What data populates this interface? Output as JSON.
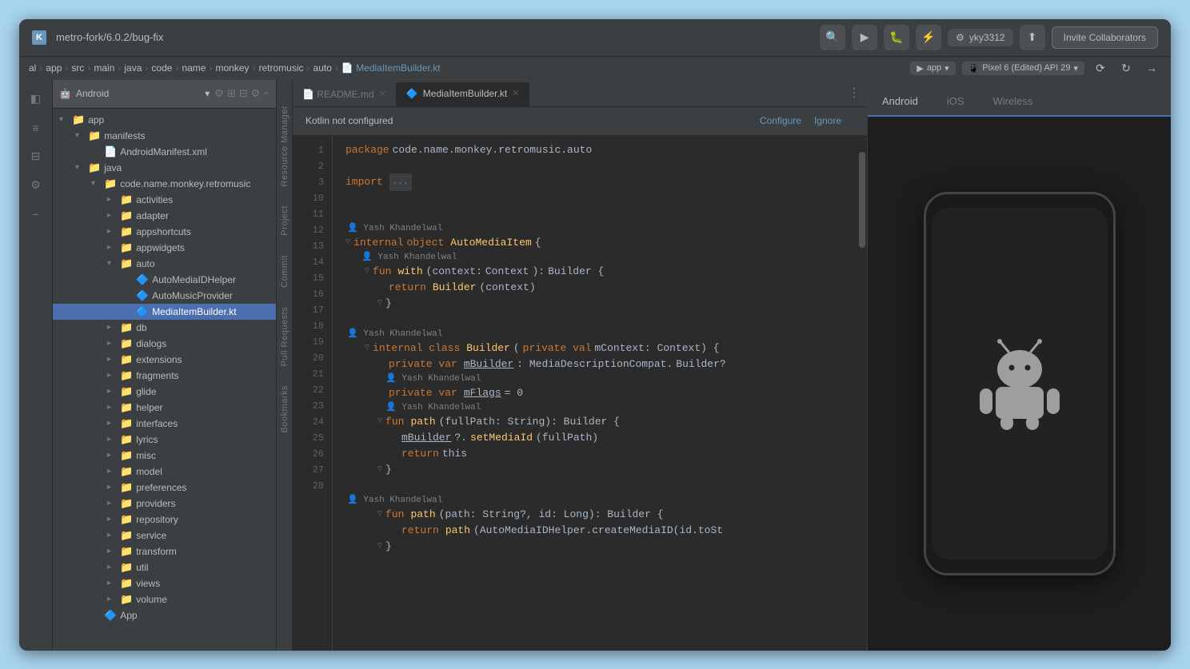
{
  "window": {
    "title": "metro-fork/6.0.2/bug-fix"
  },
  "titlebar": {
    "logo": "K",
    "title": "metro-fork/6.0.2/bug-fix",
    "invite_label": "Invite Collaborators",
    "github_user": "yky3312"
  },
  "breadcrumb": {
    "items": [
      "al",
      "app",
      "src",
      "main",
      "java",
      "code",
      "name",
      "monkey",
      "retromusic",
      "auto"
    ],
    "file": "MediaItemBuilder.kt"
  },
  "run_config": {
    "label": "▶ app"
  },
  "device_config": {
    "label": "📱 Pixel 6 (Edited) API 29"
  },
  "project_panel": {
    "title": "Android",
    "view": "Android"
  },
  "file_tree": [
    {
      "indent": 0,
      "type": "folder",
      "label": "app",
      "expanded": true
    },
    {
      "indent": 1,
      "type": "folder",
      "label": "manifests",
      "expanded": true
    },
    {
      "indent": 2,
      "type": "xml",
      "label": "AndroidManifest.xml"
    },
    {
      "indent": 1,
      "type": "folder",
      "label": "java",
      "expanded": true
    },
    {
      "indent": 2,
      "type": "folder",
      "label": "code.name.monkey.retromusic",
      "expanded": true
    },
    {
      "indent": 3,
      "type": "folder",
      "label": "activities",
      "expanded": false
    },
    {
      "indent": 3,
      "type": "folder",
      "label": "adapter",
      "expanded": false
    },
    {
      "indent": 3,
      "type": "folder",
      "label": "appshortcuts",
      "expanded": false
    },
    {
      "indent": 3,
      "type": "folder",
      "label": "appwidgets",
      "expanded": false
    },
    {
      "indent": 3,
      "type": "folder",
      "label": "auto",
      "expanded": true
    },
    {
      "indent": 4,
      "type": "kt",
      "label": "AutoMediaIDHelper"
    },
    {
      "indent": 4,
      "type": "kt",
      "label": "AutoMusicProvider"
    },
    {
      "indent": 4,
      "type": "kt",
      "label": "MediaItemBuilder.kt",
      "selected": true
    },
    {
      "indent": 3,
      "type": "folder",
      "label": "db",
      "expanded": false
    },
    {
      "indent": 3,
      "type": "folder",
      "label": "dialogs",
      "expanded": false
    },
    {
      "indent": 3,
      "type": "folder",
      "label": "extensions",
      "expanded": false
    },
    {
      "indent": 3,
      "type": "folder",
      "label": "fragments",
      "expanded": false
    },
    {
      "indent": 3,
      "type": "folder",
      "label": "glide",
      "expanded": false
    },
    {
      "indent": 3,
      "type": "folder",
      "label": "helper",
      "expanded": false
    },
    {
      "indent": 3,
      "type": "folder",
      "label": "interfaces",
      "expanded": false
    },
    {
      "indent": 3,
      "type": "folder",
      "label": "lyrics",
      "expanded": false
    },
    {
      "indent": 3,
      "type": "folder",
      "label": "misc",
      "expanded": false
    },
    {
      "indent": 3,
      "type": "folder",
      "label": "model",
      "expanded": false
    },
    {
      "indent": 3,
      "type": "folder",
      "label": "preferences",
      "expanded": false
    },
    {
      "indent": 3,
      "type": "folder",
      "label": "providers",
      "expanded": false
    },
    {
      "indent": 3,
      "type": "folder",
      "label": "repository",
      "expanded": false
    },
    {
      "indent": 3,
      "type": "folder",
      "label": "service",
      "expanded": false
    },
    {
      "indent": 3,
      "type": "folder",
      "label": "transform",
      "expanded": false
    },
    {
      "indent": 3,
      "type": "folder",
      "label": "util",
      "expanded": false
    },
    {
      "indent": 3,
      "type": "folder",
      "label": "views",
      "expanded": false
    },
    {
      "indent": 3,
      "type": "folder",
      "label": "volume",
      "expanded": false
    },
    {
      "indent": 2,
      "type": "kt",
      "label": "App"
    }
  ],
  "editor_tabs": [
    {
      "label": "README.md",
      "active": false,
      "closeable": true
    },
    {
      "label": "MediaItemBuilder.kt",
      "active": true,
      "closeable": true
    }
  ],
  "config_banner": {
    "text": "Kotlin not configured",
    "configure_label": "Configure",
    "ignore_label": "Ignore"
  },
  "code": {
    "lines": [
      {
        "num": 1,
        "content": "package code.name.monkey.retromusic.auto"
      },
      {
        "num": 2,
        "content": ""
      },
      {
        "num": 3,
        "content": "import ..."
      },
      {
        "num": 10,
        "content": ""
      },
      {
        "num": 11,
        "content": ""
      },
      {
        "num": 12,
        "content": "internal object AutoMediaItem {",
        "author": "Yash Khandelwal"
      },
      {
        "num": 13,
        "content": "    fun with(context: Context): Builder {",
        "author": "Yash Khandelwal"
      },
      {
        "num": 14,
        "content": "        return Builder(context)"
      },
      {
        "num": 15,
        "content": "    }"
      },
      {
        "num": 16,
        "content": ""
      },
      {
        "num": 17,
        "content": "    internal class Builder(private val mContext: Context) {",
        "author": "Yash Khandelwal"
      },
      {
        "num": 18,
        "content": "        private var mBuilder: MediaDescriptionCompat.Builder?"
      },
      {
        "num": 19,
        "content": "        private var mFlags = 0",
        "author": "Yash Khandelwal"
      },
      {
        "num": 20,
        "content": "        fun path(fullPath: String): Builder {"
      },
      {
        "num": 21,
        "content": "            mBuilder?.setMediaId(fullPath)"
      },
      {
        "num": 22,
        "content": "            return this"
      },
      {
        "num": 23,
        "content": "        }"
      },
      {
        "num": 24,
        "content": ""
      },
      {
        "num": 25,
        "content": "        fun path(path: String?, id: Long): Builder {",
        "author": "Yash Khandelwal"
      },
      {
        "num": 26,
        "content": "            return path(AutoMediaIDHelper.createMediaID(id.toSt"
      },
      {
        "num": 27,
        "content": "        }"
      },
      {
        "num": 28,
        "content": ""
      }
    ]
  },
  "device_panel": {
    "tabs": [
      "Android",
      "iOS",
      "Wireless"
    ],
    "active_tab": "Android"
  },
  "right_labels": [
    "Resource Manager",
    "Project",
    "Commit",
    "Pull Requests",
    "Bookmarks"
  ]
}
